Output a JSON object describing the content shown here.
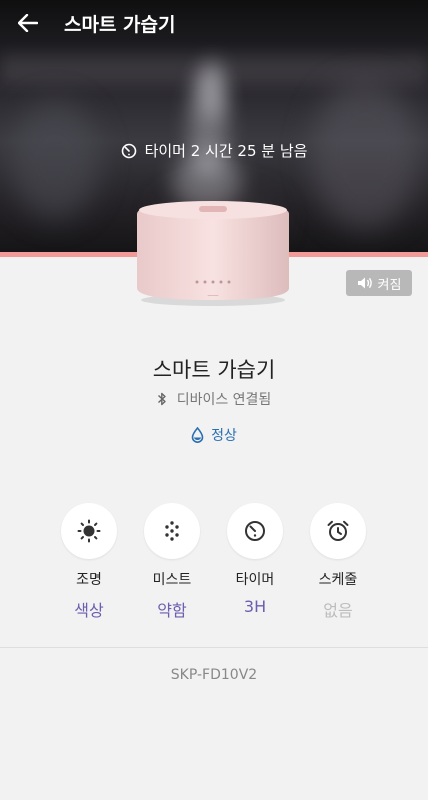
{
  "header": {
    "title": "스마트 가습기",
    "back_icon": "arrow-left-icon"
  },
  "hero": {
    "timer_text": "타이머 2 시간 25 분 남음",
    "timer_icon": "timer-icon"
  },
  "sound": {
    "label": "켜짐",
    "icon": "speaker-icon"
  },
  "device": {
    "name": "스마트 가습기",
    "connection": "디바이스 연결됨",
    "connection_icon": "bluetooth-icon",
    "status": "정상",
    "status_icon": "water-drop-icon"
  },
  "controls": [
    {
      "label": "조명",
      "value": "색상",
      "icon": "sun-icon"
    },
    {
      "label": "미스트",
      "value": "약함",
      "icon": "mist-icon"
    },
    {
      "label": "타이머",
      "value": "3H",
      "icon": "timer-icon"
    },
    {
      "label": "스케줄",
      "value": "없음",
      "icon": "alarm-clock-icon"
    }
  ],
  "model": "SKP-FD10V2",
  "colors": {
    "accent": "#f29a98",
    "value": "#6b5fb0",
    "value_off": "#bdbdbd",
    "status": "#2a6fb2"
  }
}
